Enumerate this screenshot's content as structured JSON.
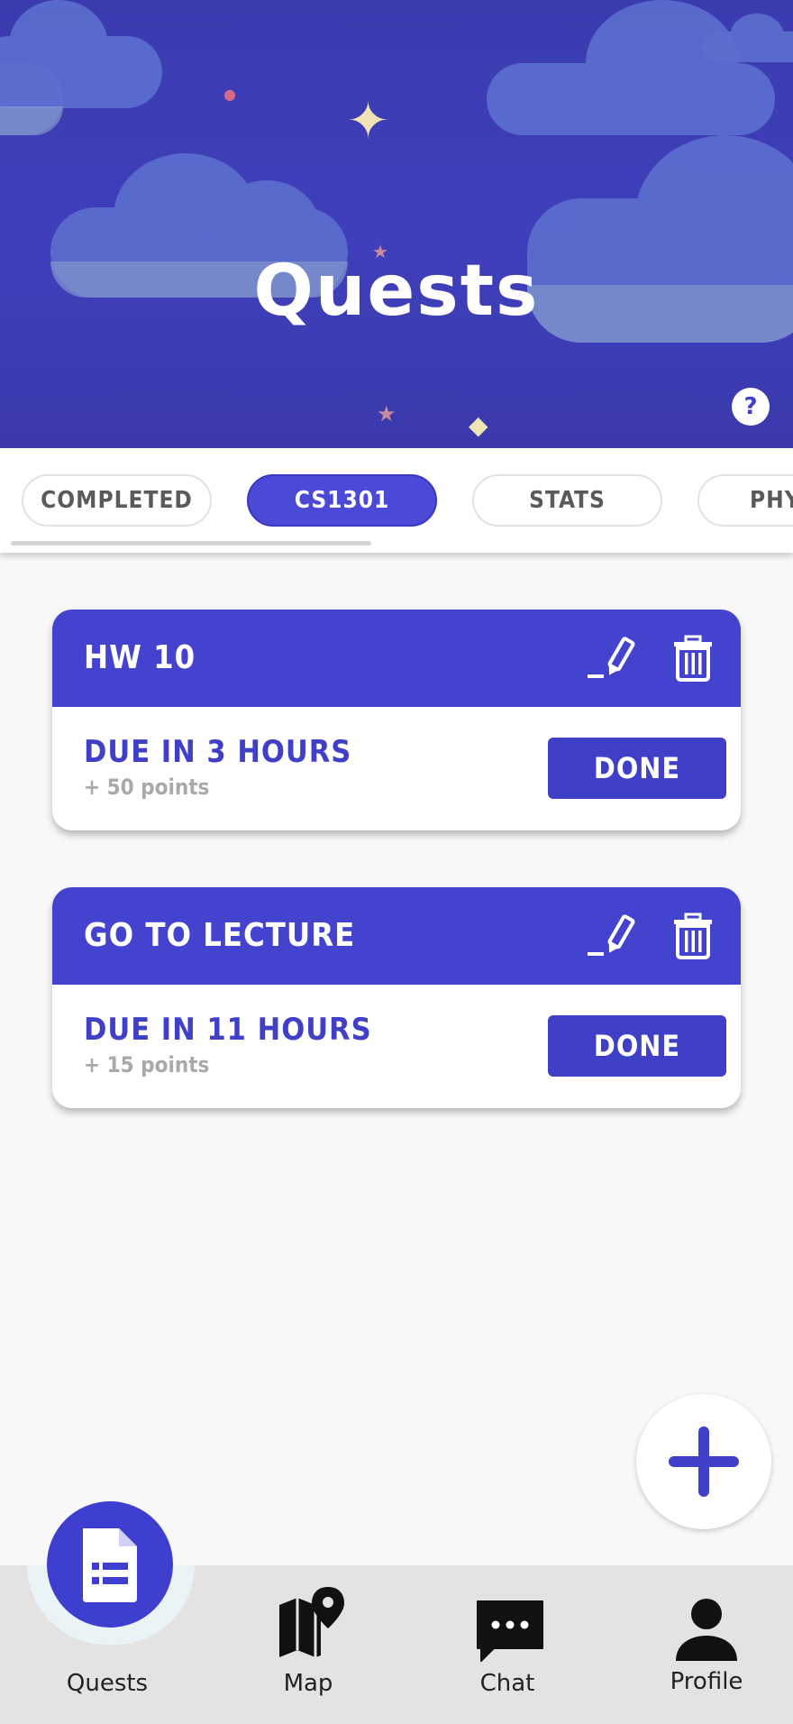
{
  "header": {
    "title": "Quests",
    "help_label": "?"
  },
  "tabs": [
    {
      "label": "COMPLETED",
      "active": false
    },
    {
      "label": "CS1301",
      "active": true
    },
    {
      "label": "STATS",
      "active": false
    },
    {
      "label": "PHY",
      "active": false
    }
  ],
  "quests": [
    {
      "title": "HW 10",
      "due": "DUE IN 3 HOURS",
      "points": "+ 50 points",
      "done_label": "DONE"
    },
    {
      "title": "GO TO LECTURE",
      "due": "DUE IN 11 HOURS",
      "points": "+ 15 points",
      "done_label": "DONE"
    }
  ],
  "bottom_nav": {
    "items": [
      {
        "label": "Quests",
        "icon": "document-list-icon",
        "active": true
      },
      {
        "label": "Map",
        "icon": "map-pin-icon",
        "active": false
      },
      {
        "label": "Chat",
        "icon": "chat-bubble-icon",
        "active": false
      },
      {
        "label": "Profile",
        "icon": "person-icon",
        "active": false
      }
    ]
  },
  "colors": {
    "accent": "#4343d0",
    "header_bg": "#3b3bb0",
    "muted_text": "#a9a9a9",
    "nav_bg": "#e3e3e3"
  }
}
